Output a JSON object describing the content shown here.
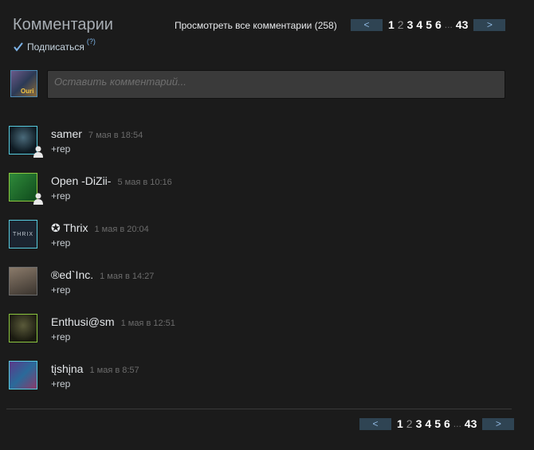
{
  "header": {
    "title": "Комментарии",
    "subscribe_label": "Подписаться",
    "help": "(?)",
    "view_all": "Просмотреть все комментарии (258)"
  },
  "pager": {
    "prev": "<",
    "next": ">",
    "current": "1",
    "pages": [
      "2",
      "3",
      "4",
      "5",
      "6"
    ],
    "ellipsis": "...",
    "last": "43"
  },
  "composer": {
    "placeholder": "Оставить комментарий...",
    "avatar_tag": "Ouri"
  },
  "comments": [
    {
      "author": "samer",
      "date": "7 мая в 18:54",
      "text": "+rep"
    },
    {
      "author": "Open -DiZii-",
      "date": "5 мая в 10:16",
      "text": "+rep"
    },
    {
      "author": "✪ Thrix",
      "date": "1 мая в 20:04",
      "text": "+rep"
    },
    {
      "author": "®ed`Inc.",
      "date": "1 мая в 14:27",
      "text": "+rep"
    },
    {
      "author": "Enthusi@sm",
      "date": "1 мая в 12:51",
      "text": "+rep"
    },
    {
      "author": "tįshįna",
      "date": "1 мая в 8:57",
      "text": "+rep"
    }
  ],
  "avatar_labels": {
    "thrix": "THRIX"
  },
  "colors": {
    "online": "#57cbde",
    "ingame": "#8bc53f",
    "offline": "#6a6a6a",
    "pager_bg": "#2f4453"
  }
}
